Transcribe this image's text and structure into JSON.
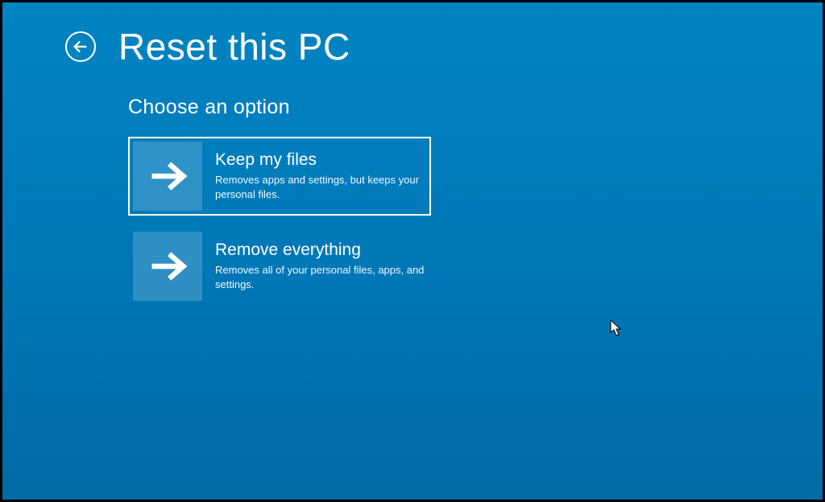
{
  "header": {
    "title": "Reset this PC"
  },
  "subtitle": "Choose an option",
  "options": [
    {
      "title": "Keep my files",
      "description": "Removes apps and settings, but keeps your personal files.",
      "selected": true
    },
    {
      "title": "Remove everything",
      "description": "Removes all of your personal files, apps, and settings.",
      "selected": false
    }
  ],
  "colors": {
    "background": "#0078b8",
    "accent": "#ffffff",
    "tile": "rgba(255,255,255,0.18)"
  }
}
